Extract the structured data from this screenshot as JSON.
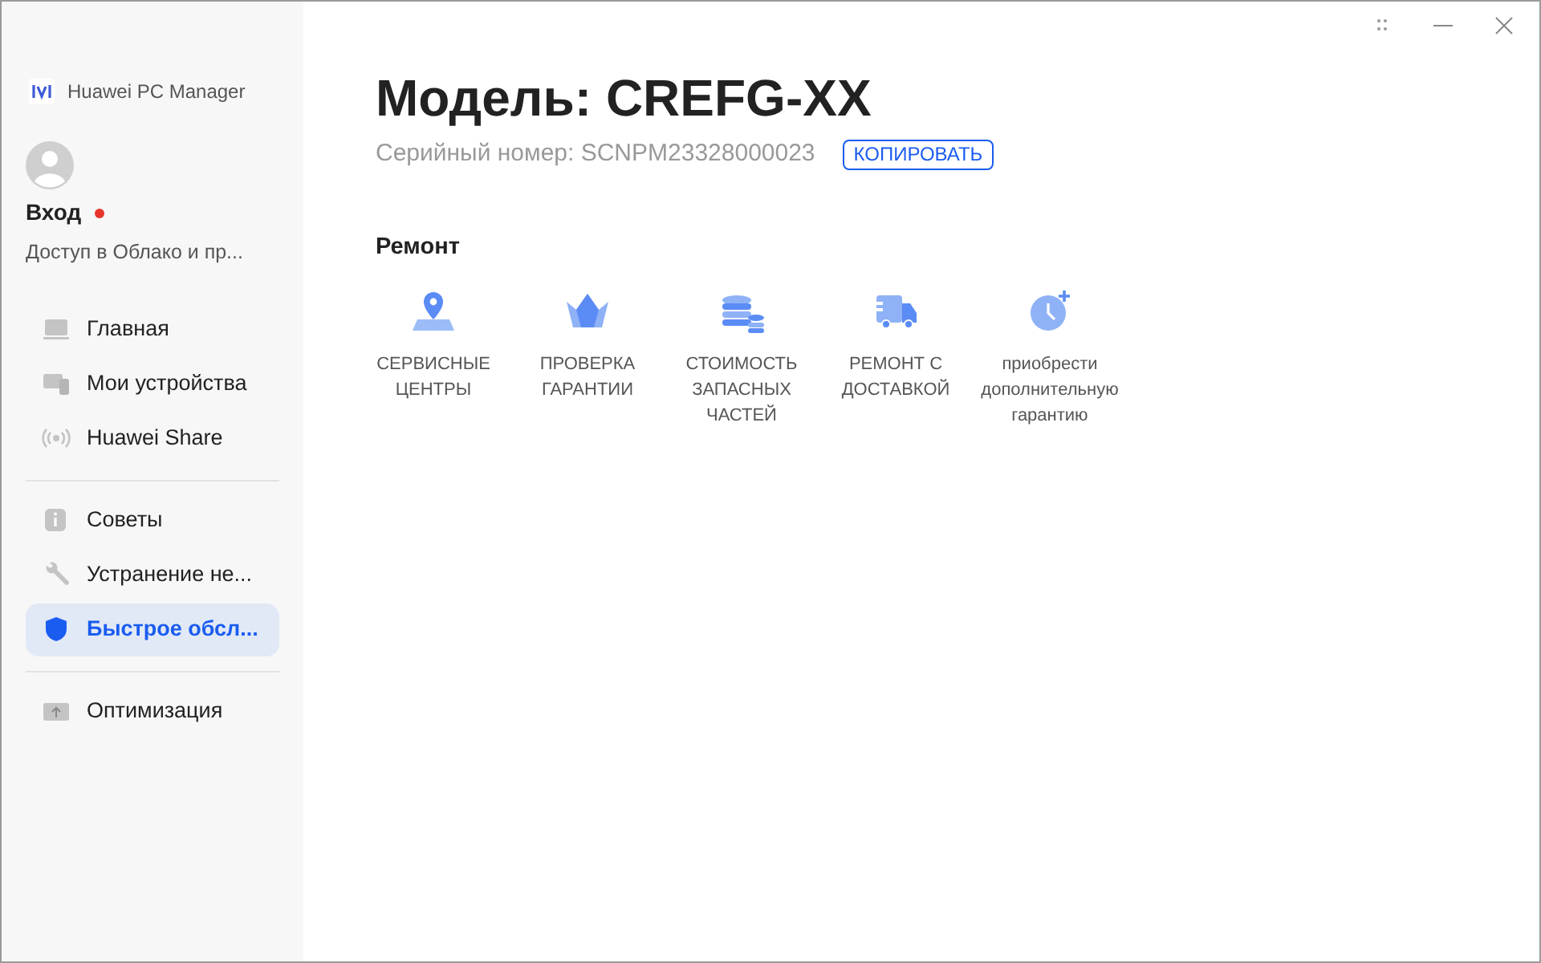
{
  "app": {
    "title": "Huawei PC Manager"
  },
  "account": {
    "name": "Вход",
    "notification": true,
    "subtitle": "Доступ в Облако и пр..."
  },
  "sidebar": {
    "groups": [
      {
        "items": [
          {
            "kind": "laptop",
            "label": "Главная",
            "selected": false
          },
          {
            "kind": "devices",
            "label": "Мои устройства",
            "selected": false
          },
          {
            "kind": "share",
            "label": "Huawei Share",
            "selected": false
          }
        ]
      },
      {
        "items": [
          {
            "kind": "tips",
            "label": "Советы",
            "selected": false
          },
          {
            "kind": "wrench",
            "label": "Устранение не...",
            "selected": false
          },
          {
            "kind": "shield",
            "label": "Быстрое обсл...",
            "selected": true
          }
        ]
      },
      {
        "items": [
          {
            "kind": "upload",
            "label": "Оптимизация",
            "selected": false
          }
        ]
      }
    ]
  },
  "device": {
    "model": "Модель: CREFG-XX",
    "serial": "Серийный номер: SCNPM23328000023",
    "copy_button": "КОПИРОВАТЬ"
  },
  "repair": {
    "title": "Ремонт",
    "tiles": [
      {
        "kind": "location",
        "lines": [
          "СЕРВИСНЫЕ",
          "ЦЕНТРЫ"
        ]
      },
      {
        "kind": "crown",
        "lines": [
          "ПРОВЕРКА",
          "ГАРАНТИИ"
        ]
      },
      {
        "kind": "coins",
        "lines": [
          "СТОИМОСТЬ",
          "ЗАПАСНЫХ",
          "ЧАСТЕЙ"
        ]
      },
      {
        "kind": "truck",
        "lines": [
          "РЕМОНТ С",
          "ДОСТАВКОЙ"
        ]
      },
      {
        "kind": "clock",
        "lines": [
          "приобрести",
          "дополнительную",
          "гарантию"
        ]
      }
    ]
  }
}
